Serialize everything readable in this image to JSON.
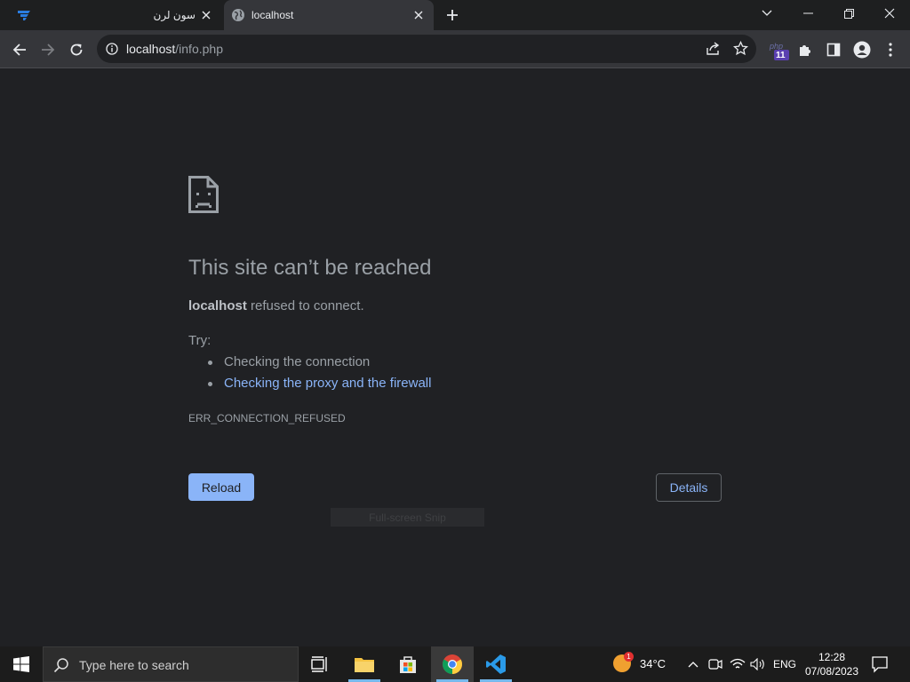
{
  "tabs": [
    {
      "title": "سون لرن"
    },
    {
      "title": "localhost"
    }
  ],
  "omnibox": {
    "host": "localhost",
    "path": "/info.php"
  },
  "extension_badge": "11",
  "error": {
    "title": "This site can’t be reached",
    "host": "localhost",
    "message": " refused to connect.",
    "try_label": "Try:",
    "suggestions": [
      "Checking the connection",
      "Checking the proxy and the firewall"
    ],
    "code": "ERR_CONNECTION_REFUSED",
    "reload_label": "Reload",
    "details_label": "Details",
    "fullscreen_tip": "Full-screen Snip"
  },
  "taskbar": {
    "search_placeholder": "Type here to search",
    "weather_temp": "34°C",
    "weather_badge": "1",
    "language": "ENG",
    "time": "12:28",
    "date": "07/08/2023"
  },
  "colors": {
    "accent": "#8ab4f8",
    "page_bg": "#202124",
    "toolbar": "#35363a"
  }
}
